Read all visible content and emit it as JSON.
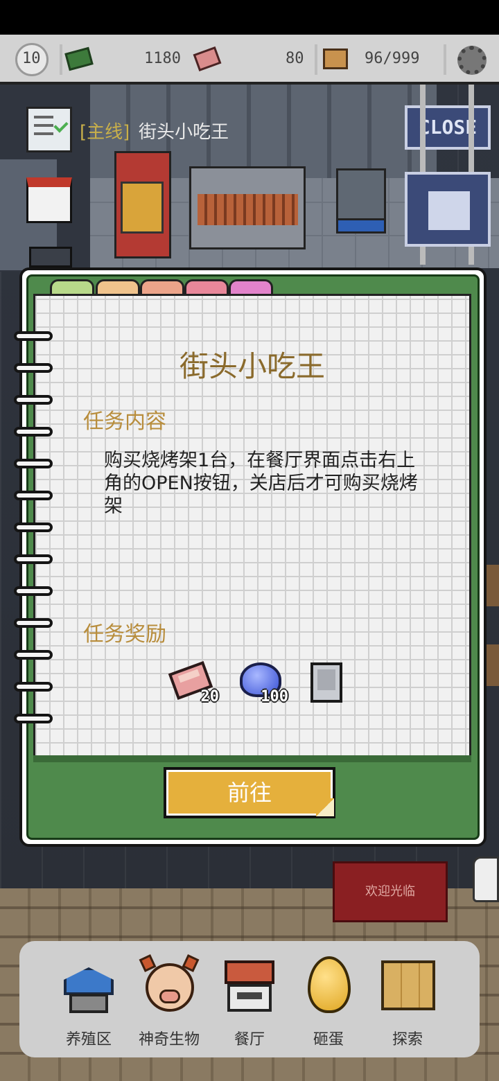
{
  "hud": {
    "level": "10",
    "coins": "1180",
    "gems": "80",
    "capacity": "96/999"
  },
  "quest_tracker": {
    "tag": "[主线]",
    "name": "街头小吃王"
  },
  "signs": {
    "close": "CLOSE"
  },
  "quest_modal": {
    "title": "街头小吃王",
    "content_heading": "任务内容",
    "description": "购买烧烤架1台，在餐厅界面点击右上角的OPEN按钮，关店后才可购买烧烤架",
    "reward_heading": "任务奖励",
    "rewards": [
      {
        "icon": "meat-gem-icon",
        "count": "20"
      },
      {
        "icon": "exp-orb-icon",
        "count": "100"
      },
      {
        "icon": "grill-item-icon",
        "count": ""
      }
    ],
    "go_button": "前往"
  },
  "welcome_mat": "欢迎光临",
  "nav": [
    {
      "label": "养殖区",
      "icon": "farm-house-icon"
    },
    {
      "label": "神奇生物",
      "icon": "creature-pig-icon"
    },
    {
      "label": "餐厅",
      "icon": "restaurant-icon"
    },
    {
      "label": "砸蛋",
      "icon": "golden-egg-icon"
    },
    {
      "label": "探索",
      "icon": "map-icon"
    }
  ],
  "colors": {
    "modal_green": "#4f8a4c",
    "button_yellow": "#e5b03c",
    "title_brown": "#8a6a2c",
    "section_gold": "#b88d3c"
  }
}
